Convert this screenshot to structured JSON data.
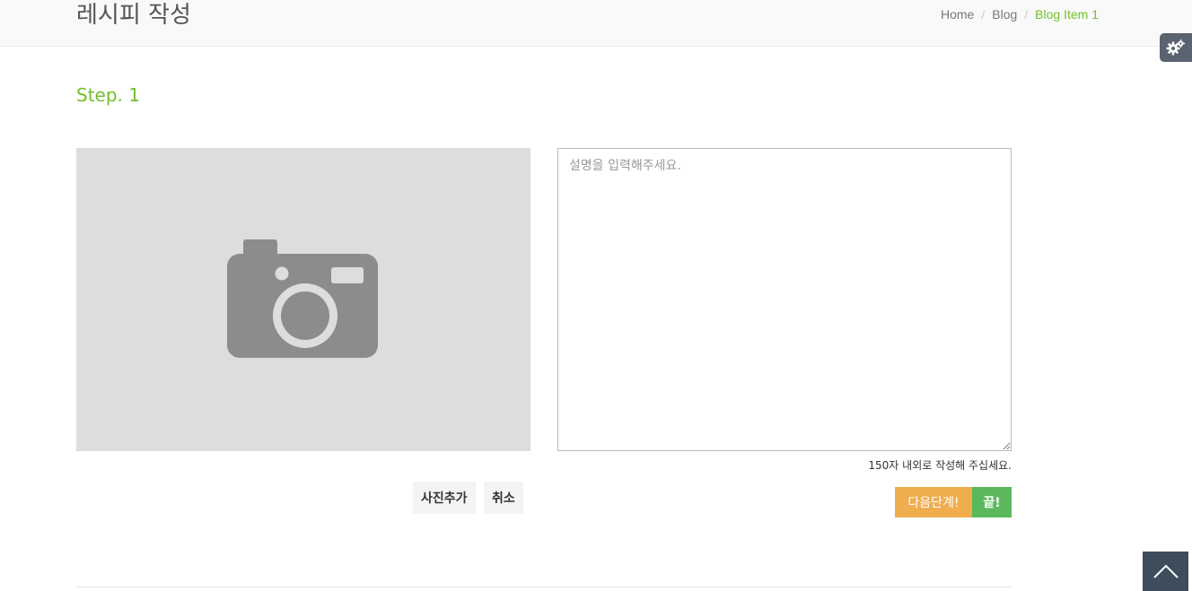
{
  "header": {
    "title": "레시피 작성",
    "breadcrumb": {
      "home": "Home",
      "blog": "Blog",
      "current": "Blog Item 1",
      "separator": "/"
    }
  },
  "colors": {
    "accent": "#72c02c",
    "next_button": "#f0ad4e",
    "finish_button": "#5cb85c",
    "photo_placeholder": "#dddddd"
  },
  "step": {
    "title": "Step. 1"
  },
  "photo": {
    "icon": "camera-icon",
    "add_label": "사진추가",
    "cancel_label": "취소"
  },
  "description": {
    "placeholder": "설명을 입력해주세요.",
    "value": "",
    "hint": "150자 내외로 작성해 주십세요."
  },
  "actions": {
    "next_label": "다음단계!",
    "finish_label": "끝!"
  },
  "widgets": {
    "settings_icon": "gears-icon",
    "back_to_top_icon": "chevron-up-icon"
  }
}
